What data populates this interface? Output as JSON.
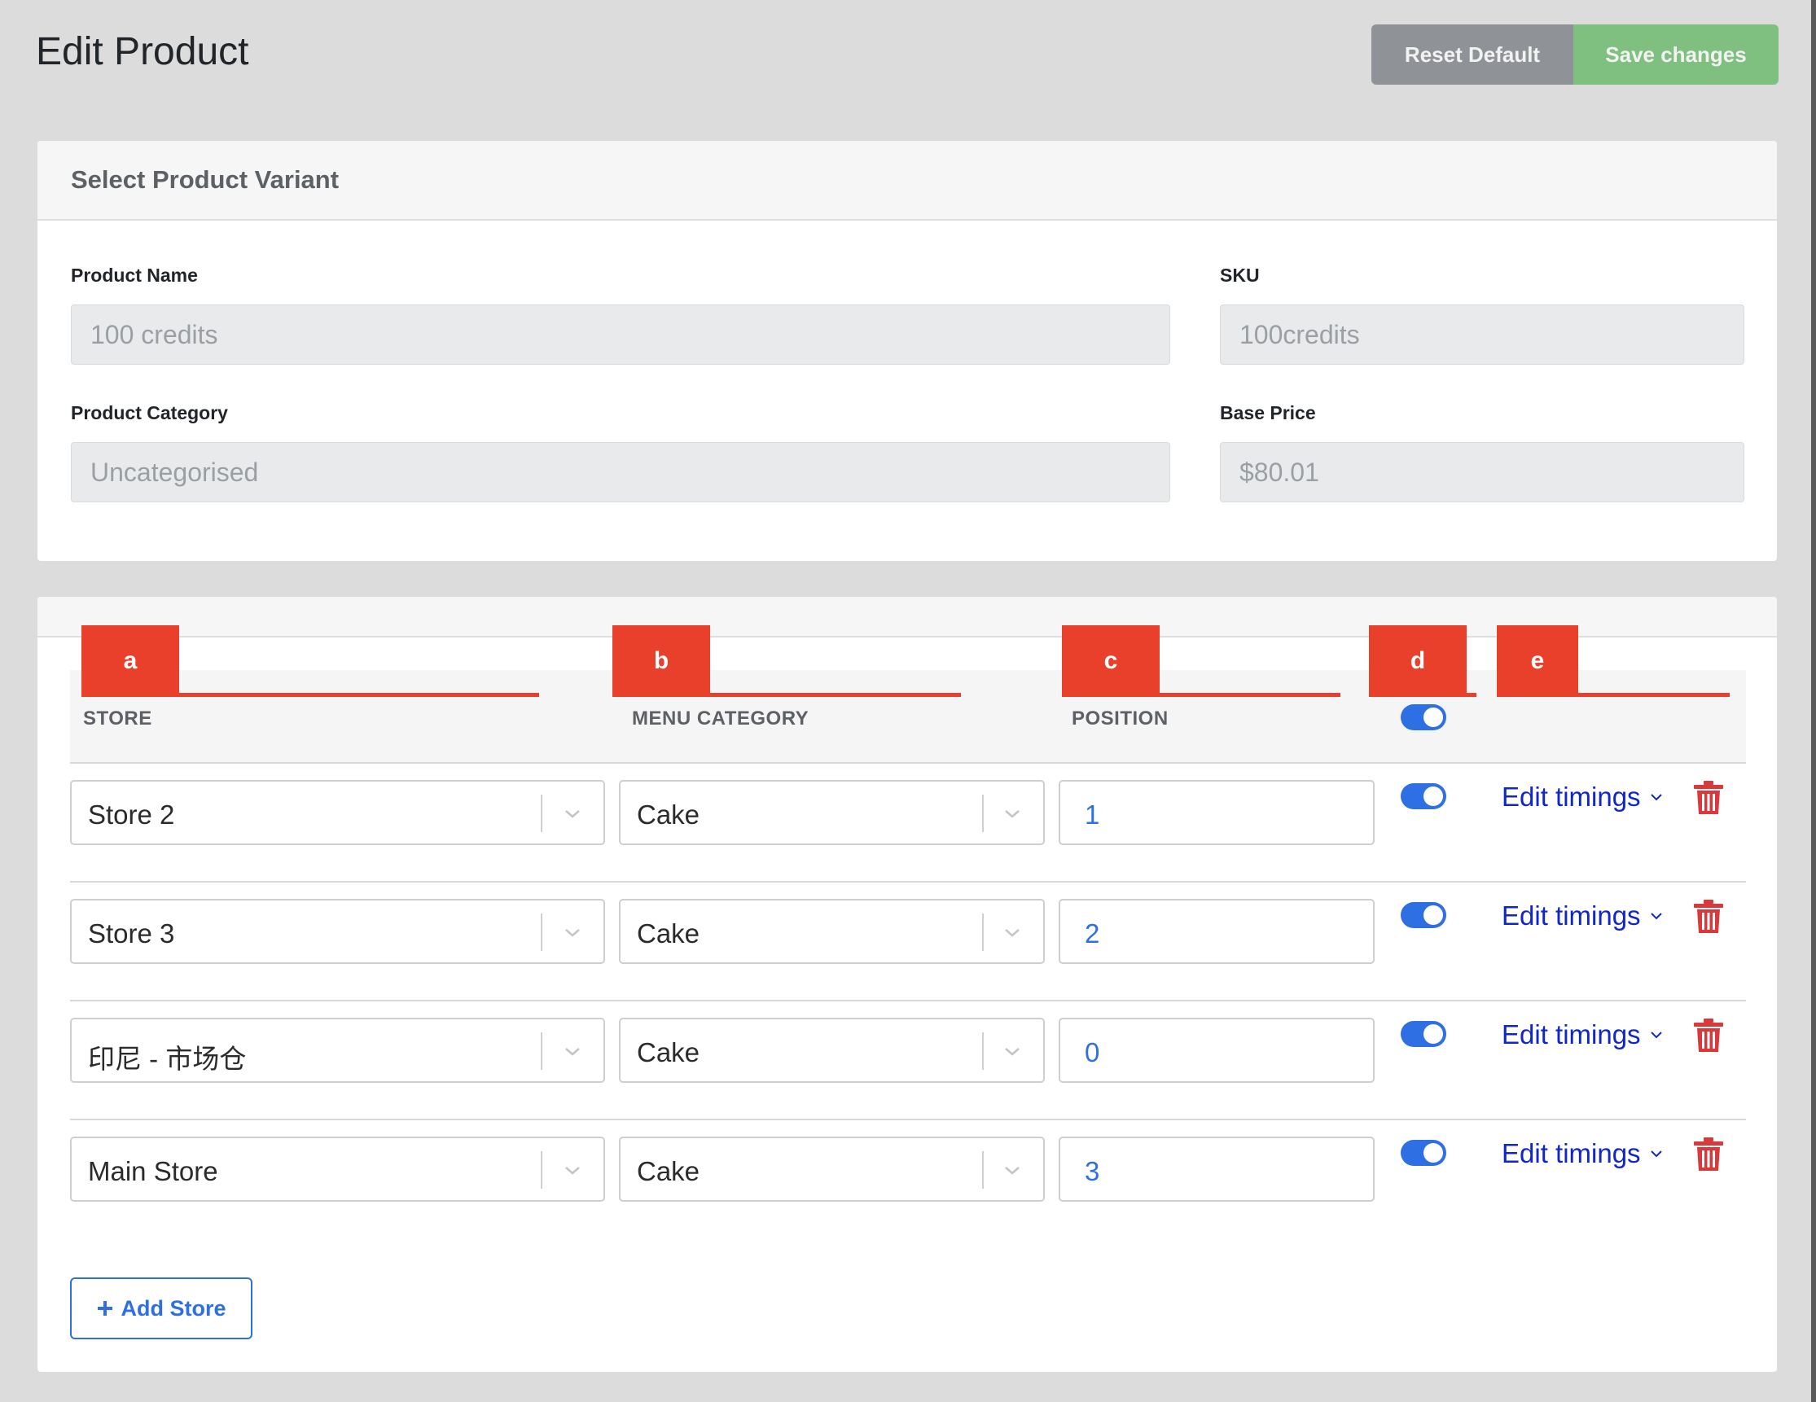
{
  "page": {
    "title": "Edit Product",
    "reset_label": "Reset Default",
    "save_label": "Save changes"
  },
  "variant_card": {
    "title": "Select Product Variant",
    "product_name_label": "Product Name",
    "product_name_value": "100 credits",
    "sku_label": "SKU",
    "sku_value": "100credits",
    "category_label": "Product Category",
    "category_value": "Uncategorised",
    "base_price_label": "Base Price",
    "base_price_value": "$80.01"
  },
  "stores_table": {
    "markers": [
      "a",
      "b",
      "c",
      "d",
      "e"
    ],
    "columns": [
      "STORE",
      "MENU CATEGORY",
      "POSITION"
    ],
    "header_toggle_on": true,
    "rows": [
      {
        "store": "Store 2",
        "category": "Cake",
        "position": "1",
        "enabled": true,
        "edit_label": "Edit timings"
      },
      {
        "store": "Store 3",
        "category": "Cake",
        "position": "2",
        "enabled": true,
        "edit_label": "Edit timings"
      },
      {
        "store": "印尼 - 市场仓",
        "category": "Cake",
        "position": "0",
        "enabled": true,
        "edit_label": "Edit timings"
      },
      {
        "store": "Main Store",
        "category": "Cake",
        "position": "3",
        "enabled": true,
        "edit_label": "Edit timings"
      }
    ],
    "add_store_label": "Add Store"
  },
  "colors": {
    "accent_blue": "#2f6fe4",
    "link_blue": "#1126c9",
    "danger_red": "#d9393b",
    "marker_red": "#e8402a",
    "save_green": "#7fbf80",
    "reset_gray": "#8f9398"
  },
  "icons": [
    "chevron-down-icon",
    "trash-icon",
    "plus-icon"
  ]
}
